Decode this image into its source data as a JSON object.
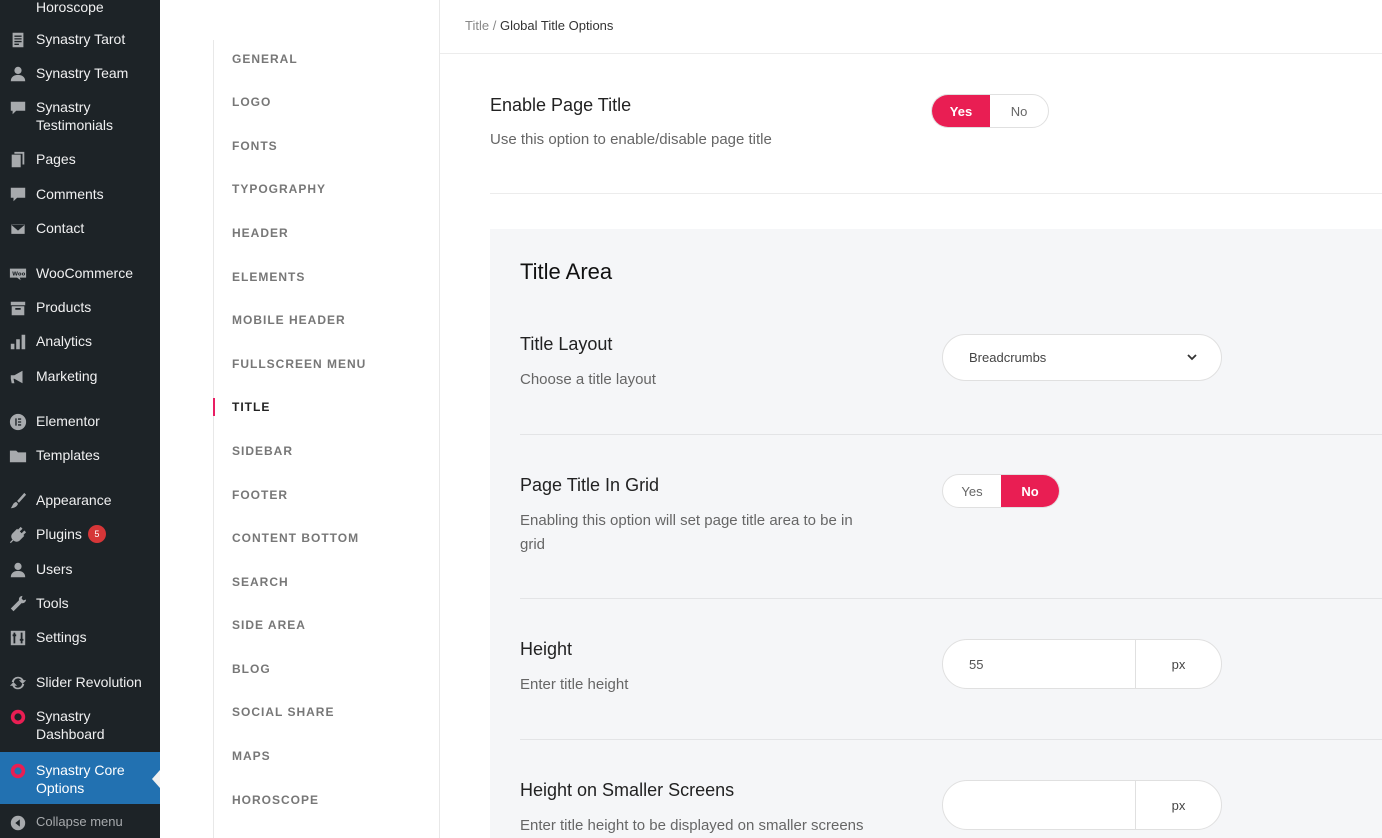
{
  "wp_menu": {
    "items": [
      {
        "label": "Horoscope",
        "icon": "horoscope-icon"
      },
      {
        "label": "Synastry Tarot",
        "icon": "document-icon"
      },
      {
        "label": "Synastry Team",
        "icon": "user-icon"
      },
      {
        "label": "Synastry Testimonials",
        "icon": "comment-bubble-icon"
      },
      {
        "label": "Pages",
        "icon": "pages-icon"
      },
      {
        "label": "Comments",
        "icon": "comments-icon"
      },
      {
        "label": "Contact",
        "icon": "mail-icon"
      },
      {
        "label": "WooCommerce",
        "icon": "woocommerce-icon"
      },
      {
        "label": "Products",
        "icon": "archive-icon"
      },
      {
        "label": "Analytics",
        "icon": "bar-chart-icon"
      },
      {
        "label": "Marketing",
        "icon": "megaphone-icon"
      },
      {
        "label": "Elementor",
        "icon": "elementor-icon"
      },
      {
        "label": "Templates",
        "icon": "folder-icon"
      },
      {
        "label": "Appearance",
        "icon": "paintbrush-icon"
      },
      {
        "label": "Plugins",
        "icon": "plugin-icon",
        "badge": "5"
      },
      {
        "label": "Users",
        "icon": "users-icon"
      },
      {
        "label": "Tools",
        "icon": "wrench-icon"
      },
      {
        "label": "Settings",
        "icon": "settings-sliders-icon"
      },
      {
        "label": "Slider Revolution",
        "icon": "refresh-icon"
      },
      {
        "label": "Synastry Dashboard",
        "icon": "synastry-logo-icon"
      },
      {
        "label": "Synastry Core Options",
        "icon": "synastry-logo-icon"
      }
    ],
    "collapse_label": "Collapse menu"
  },
  "options_nav": [
    "GENERAL",
    "LOGO",
    "FONTS",
    "TYPOGRAPHY",
    "HEADER",
    "ELEMENTS",
    "MOBILE HEADER",
    "FULLSCREEN MENU",
    "TITLE",
    "SIDEBAR",
    "FOOTER",
    "CONTENT BOTTOM",
    "SEARCH",
    "SIDE AREA",
    "BLOG",
    "SOCIAL SHARE",
    "MAPS",
    "HOROSCOPE"
  ],
  "breadcrumb": {
    "parent": "Title",
    "separator": "/",
    "current": "Global Title Options"
  },
  "enable_page_title": {
    "label": "Enable Page Title",
    "description": "Use this option to enable/disable page title",
    "yes": "Yes",
    "no": "No",
    "selected": "Yes"
  },
  "title_area": {
    "heading": "Title Area",
    "title_layout": {
      "label": "Title Layout",
      "description": "Choose a title layout",
      "value": "Breadcrumbs"
    },
    "page_title_in_grid": {
      "label": "Page Title In Grid",
      "description": "Enabling this option will set page title area to be in grid",
      "yes": "Yes",
      "no": "No",
      "selected": "No"
    },
    "height": {
      "label": "Height",
      "description": "Enter title height",
      "value": "55",
      "unit": "px"
    },
    "height_smaller": {
      "label": "Height on Smaller Screens",
      "description": "Enter title height to be displayed on smaller screens",
      "value": "",
      "unit": "px"
    }
  },
  "colors": {
    "accent": "#e91e53",
    "wp_sidebar": "#1d2327",
    "wp_current": "#2271b1"
  }
}
